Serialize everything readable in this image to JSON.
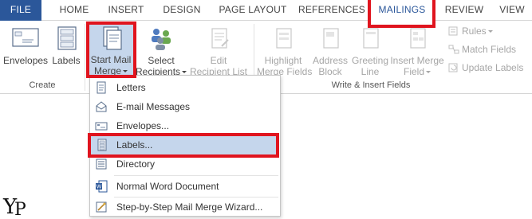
{
  "tabs": {
    "file": "FILE",
    "home": "HOME",
    "insert": "INSERT",
    "design": "DESIGN",
    "page_layout": "PAGE LAYOUT",
    "references": "REFERENCES",
    "mailings": "MAILINGS",
    "review": "REVIEW",
    "view": "VIEW"
  },
  "ribbon": {
    "create": {
      "group_label": "Create",
      "envelopes": "Envelopes",
      "labels": "Labels"
    },
    "start_mail_merge": {
      "line1": "Start Mail",
      "line2": "Merge"
    },
    "select_recipients": {
      "line1": "Select",
      "line2": "Recipients"
    },
    "edit_recipient_list": {
      "line1": "Edit",
      "line2": "Recipient List"
    },
    "write_insert": {
      "group_label": "Write & Insert Fields",
      "highlight": {
        "line1": "Highlight",
        "line2": "Merge Fields"
      },
      "address": {
        "line1": "Address",
        "line2": "Block"
      },
      "greeting": {
        "line1": "Greeting",
        "line2": "Line"
      },
      "insert_merge": {
        "line1": "Insert Merge",
        "line2": "Field"
      },
      "rules": "Rules",
      "match_fields": "Match Fields",
      "update_labels": "Update Labels"
    }
  },
  "menu": {
    "items": [
      {
        "label": "Letters",
        "icon": "letter-icon"
      },
      {
        "label": "E-mail Messages",
        "icon": "email-icon"
      },
      {
        "label": "Envelopes...",
        "icon": "envelope-icon"
      },
      {
        "label": "Labels...",
        "icon": "labels-icon"
      },
      {
        "label": "Directory",
        "icon": "directory-icon"
      },
      {
        "label": "Normal Word Document",
        "icon": "word-document-icon"
      },
      {
        "label": "Step-by-Step Mail Merge Wizard...",
        "icon": "wizard-icon"
      }
    ],
    "highlighted_index": 3
  },
  "colors": {
    "file_tab": "#2b579a",
    "highlight": "#c5d6ec",
    "red_box": "#e0141e"
  }
}
